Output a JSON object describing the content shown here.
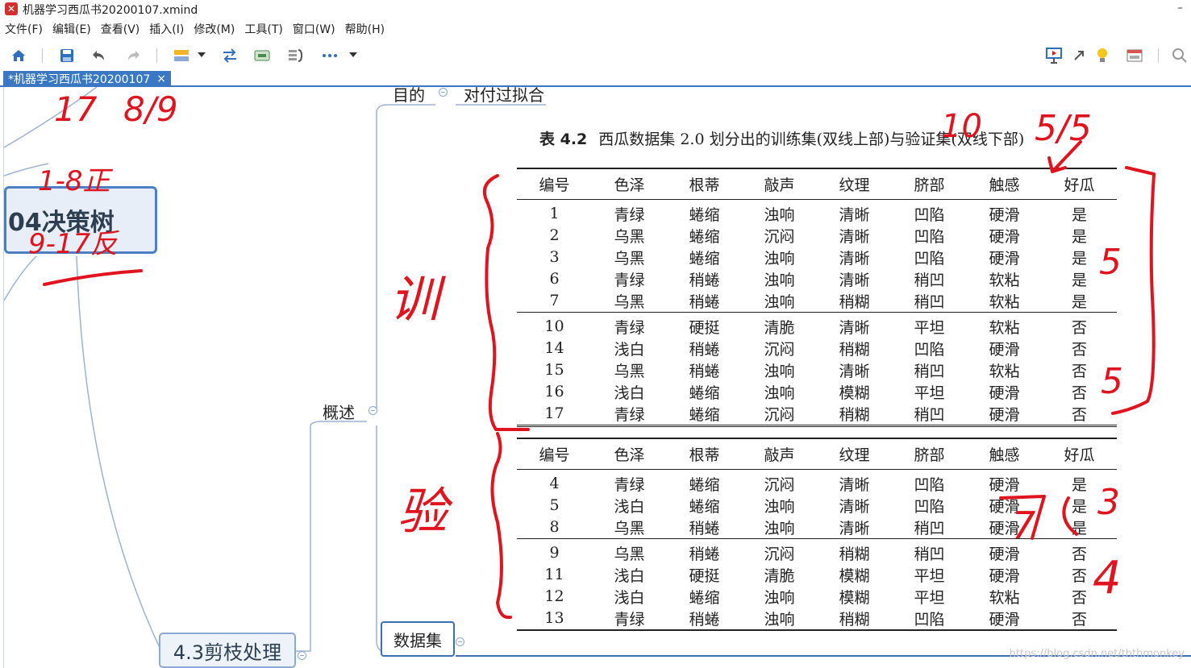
{
  "window": {
    "title": "机器学习西瓜书20200107.xmind"
  },
  "menu": [
    "文件(F)",
    "编辑(E)",
    "查看(V)",
    "插入(I)",
    "修改(M)",
    "工具(T)",
    "窗口(W)",
    "帮助(H)"
  ],
  "toolbar": {
    "left_icons": [
      "home-icon",
      "save-icon",
      "undo-icon",
      "redo-icon",
      "insert-topic-icon",
      "dropdown-icon",
      "relationship-icon",
      "boundary-icon",
      "summary-icon",
      "more-icon",
      "dropdown-icon"
    ],
    "right_icons": [
      "presentation-icon",
      "share-icon",
      "lightbulb-icon",
      "layout-icon",
      "search-icon"
    ]
  },
  "tab": {
    "label": "*机器学习西瓜书20200107",
    "close": "×"
  },
  "mindmap": {
    "main_topic": "04决策树",
    "sub_topic": "4.3剪枝处理",
    "branch_overview": "概述",
    "top_left_label": "目的",
    "top_right_label": "对付过拟合",
    "dataset_node": "数据集"
  },
  "table": {
    "caption_prefix": "表 4.2",
    "caption": "西瓜数据集 2.0 划分出的训练集(双线上部)与验证集(双线下部)",
    "headers": [
      "编号",
      "色泽",
      "根蒂",
      "敲声",
      "纹理",
      "脐部",
      "触感",
      "好瓜"
    ],
    "train_groups": [
      [
        [
          "1",
          "青绿",
          "蜷缩",
          "浊响",
          "清晰",
          "凹陷",
          "硬滑",
          "是"
        ],
        [
          "2",
          "乌黑",
          "蜷缩",
          "沉闷",
          "清晰",
          "凹陷",
          "硬滑",
          "是"
        ],
        [
          "3",
          "乌黑",
          "蜷缩",
          "浊响",
          "清晰",
          "凹陷",
          "硬滑",
          "是"
        ],
        [
          "6",
          "青绿",
          "稍蜷",
          "浊响",
          "清晰",
          "稍凹",
          "软粘",
          "是"
        ],
        [
          "7",
          "乌黑",
          "稍蜷",
          "浊响",
          "稍糊",
          "稍凹",
          "软粘",
          "是"
        ]
      ],
      [
        [
          "10",
          "青绿",
          "硬挺",
          "清脆",
          "清晰",
          "平坦",
          "软粘",
          "否"
        ],
        [
          "14",
          "浅白",
          "稍蜷",
          "沉闷",
          "稍糊",
          "凹陷",
          "硬滑",
          "否"
        ],
        [
          "15",
          "乌黑",
          "稍蜷",
          "浊响",
          "清晰",
          "稍凹",
          "软粘",
          "否"
        ],
        [
          "16",
          "浅白",
          "蜷缩",
          "浊响",
          "模糊",
          "平坦",
          "硬滑",
          "否"
        ],
        [
          "17",
          "青绿",
          "蜷缩",
          "沉闷",
          "稍糊",
          "稍凹",
          "硬滑",
          "否"
        ]
      ]
    ],
    "valid_groups": [
      [
        [
          "4",
          "青绿",
          "蜷缩",
          "沉闷",
          "清晰",
          "凹陷",
          "硬滑",
          "是"
        ],
        [
          "5",
          "浅白",
          "蜷缩",
          "浊响",
          "清晰",
          "凹陷",
          "硬滑",
          "是"
        ],
        [
          "8",
          "乌黑",
          "稍蜷",
          "浊响",
          "清晰",
          "稍凹",
          "硬滑",
          "是"
        ]
      ],
      [
        [
          "9",
          "乌黑",
          "稍蜷",
          "沉闷",
          "稍糊",
          "稍凹",
          "硬滑",
          "否"
        ],
        [
          "11",
          "浅白",
          "硬挺",
          "清脆",
          "模糊",
          "平坦",
          "硬滑",
          "否"
        ],
        [
          "12",
          "浅白",
          "蜷缩",
          "浊响",
          "模糊",
          "平坦",
          "软粘",
          "否"
        ],
        [
          "13",
          "青绿",
          "稍蜷",
          "浊响",
          "稍糊",
          "凹陷",
          "硬滑",
          "否"
        ]
      ]
    ]
  },
  "annotations": {
    "top_left_1": "17",
    "top_left_2": "8/9",
    "left_mid": "1-8正",
    "left_low": "9-17反",
    "numbers_top": "10",
    "ratio_top": "5/5",
    "train_label": "训",
    "valid_label": "验",
    "count_pos_train": "5",
    "count_neg_train": "5",
    "count_valid_a": "7",
    "count_valid_b": "3",
    "count_valid_c": "4"
  },
  "colors": {
    "accent": "#3a78c4",
    "ink": "#e0141e",
    "node_border": "#4d7fc4"
  },
  "watermark": "https://blog.csdn.net/ththmonkey"
}
